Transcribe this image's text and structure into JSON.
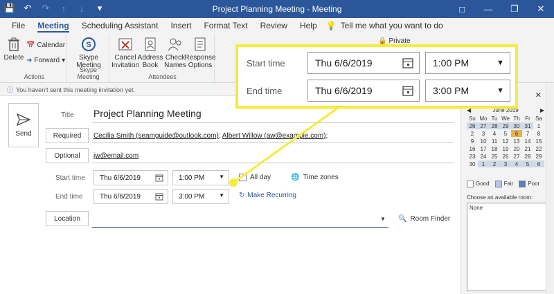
{
  "window": {
    "title": "Project Planning Meeting  -  Meeting",
    "buttons": [
      "minimize",
      "restore",
      "close"
    ]
  },
  "qat": {
    "icons": [
      "save-icon",
      "undo-icon",
      "redo-icon",
      "up-icon",
      "down-icon",
      "dropdown-icon"
    ]
  },
  "tabs": [
    "File",
    "Meeting",
    "Scheduling Assistant",
    "Insert",
    "Format Text",
    "Review",
    "Help"
  ],
  "active_tab": "Meeting",
  "tellme": "Tell me what you want to do",
  "ribbon": {
    "actions": {
      "delete": "Delete",
      "calendar": "Calendar",
      "forward": "Forward",
      "label": "Actions"
    },
    "skype": {
      "button": "Skype Meeting",
      "label": "Skype Meeting"
    },
    "attendees": {
      "cancel": "Cancel Invitation",
      "address": "Address Book",
      "check": "Check Names",
      "response": "Response Options",
      "label": "Attendees"
    },
    "private": "Private"
  },
  "infobar": "You haven't sent this meeting invitation yet.",
  "form": {
    "send": "Send",
    "title_label": "Title",
    "title_value": "Project Planning Meeting",
    "required_label": "Required",
    "required_value_1": "Cecilia Smith (seamguide@outlook.com)",
    "required_value_2": "Albert Willow (aw@example.com)",
    "optional_label": "Optional",
    "optional_value": "jw@email.com",
    "start_label": "Start time",
    "start_date": "Thu 6/6/2019",
    "start_time": "1:00 PM",
    "end_label": "End time",
    "end_date": "Thu 6/6/2019",
    "end_time": "3:00 PM",
    "allday": "All day",
    "timezones": "Time zones",
    "recurring": "Make Recurring",
    "location_label": "Location",
    "location_value": "",
    "room_finder": "Room Finder"
  },
  "minical": {
    "month": "June 2019",
    "days": [
      "Su",
      "Mo",
      "Tu",
      "We",
      "Th",
      "Fr",
      "Sa"
    ],
    "weeks": [
      [
        "26",
        "27",
        "28",
        "29",
        "30",
        "31",
        "1"
      ],
      [
        "2",
        "3",
        "4",
        "5",
        "6",
        "7",
        "8"
      ],
      [
        "9",
        "10",
        "11",
        "12",
        "13",
        "14",
        "15"
      ],
      [
        "16",
        "17",
        "18",
        "19",
        "20",
        "21",
        "22"
      ],
      [
        "23",
        "24",
        "25",
        "26",
        "27",
        "28",
        "29"
      ],
      [
        "30",
        "1",
        "2",
        "3",
        "4",
        "5",
        "6"
      ]
    ]
  },
  "legend": [
    "Good",
    "Fair",
    "Poor"
  ],
  "legend_colors": [
    "#ffffff",
    "#b4c7e7",
    "#5b7fb5"
  ],
  "rooms": {
    "label": "Choose an available room:",
    "items": [
      "None"
    ]
  },
  "callout": {
    "start_label": "Start time",
    "start_date": "Thu 6/6/2019",
    "start_time": "1:00 PM",
    "end_label": "End time",
    "end_date": "Thu 6/6/2019",
    "end_time": "3:00 PM"
  },
  "colors": {
    "accent": "#2b579a",
    "highlight": "#f5ec3b"
  }
}
